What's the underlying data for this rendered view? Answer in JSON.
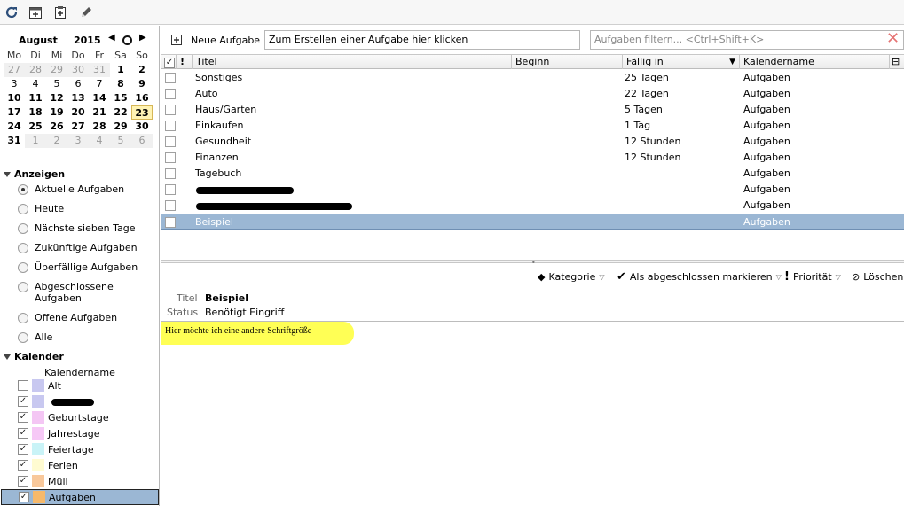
{
  "toolbar": {
    "icons": [
      "refresh-icon",
      "new-appointment-icon",
      "new-task-icon",
      "edit-icon"
    ]
  },
  "calendar": {
    "month": "August",
    "year": "2015",
    "dow": [
      "Mo",
      "Di",
      "Mi",
      "Do",
      "Fr",
      "Sa",
      "So"
    ],
    "weeks": [
      [
        "27",
        "28",
        "29",
        "30",
        "31",
        "1",
        "2"
      ],
      [
        "3",
        "4",
        "5",
        "6",
        "7",
        "8",
        "9"
      ],
      [
        "10",
        "11",
        "12",
        "13",
        "14",
        "15",
        "16"
      ],
      [
        "17",
        "18",
        "19",
        "20",
        "21",
        "22",
        "23"
      ],
      [
        "24",
        "25",
        "26",
        "27",
        "28",
        "29",
        "30"
      ],
      [
        "31",
        "1",
        "2",
        "3",
        "4",
        "5",
        "6"
      ]
    ]
  },
  "sections": {
    "show": "Anzeigen",
    "calendar": "Kalender",
    "calendar_col": "Kalendername"
  },
  "filters": [
    {
      "label": "Aktuelle Aufgaben",
      "selected": true
    },
    {
      "label": "Heute"
    },
    {
      "label": "Nächste sieben Tage"
    },
    {
      "label": "Zukünftige Aufgaben"
    },
    {
      "label": "Überfällige Aufgaben"
    },
    {
      "label": "Abgeschlossene Aufgaben"
    },
    {
      "label": "Offene Aufgaben"
    },
    {
      "label": "Alle"
    }
  ],
  "calendars": [
    {
      "label": "Alt",
      "checked": false,
      "color": "#c8c8f0"
    },
    {
      "label": "",
      "checked": true,
      "color": "#c8c8f0"
    },
    {
      "label": "Geburtstage",
      "checked": true,
      "color": "#f4c6f4"
    },
    {
      "label": "Jahrestage",
      "checked": true,
      "color": "#f6c8f6"
    },
    {
      "label": "Feiertage",
      "checked": true,
      "color": "#c9f3f7"
    },
    {
      "label": "Ferien",
      "checked": true,
      "color": "#fffbd1"
    },
    {
      "label": "Müll",
      "checked": true,
      "color": "#f8c89b"
    },
    {
      "label": "Aufgaben",
      "checked": true,
      "color": "#f6b96b",
      "selected": true
    }
  ],
  "newtask": {
    "label": "Neue Aufgabe",
    "placeholder": "Zum Erstellen einer Aufgabe hier klicken",
    "filter_placeholder": "Aufgaben filtern... <Ctrl+Shift+K>"
  },
  "columns": {
    "title": "Titel",
    "start": "Beginn",
    "due": "Fällig in",
    "calendar": "Kalendername"
  },
  "tasks": [
    {
      "title": "Sonstiges",
      "due": "25 Tagen",
      "calendar": "Aufgaben"
    },
    {
      "title": "Auto",
      "due": "22 Tagen",
      "calendar": "Aufgaben"
    },
    {
      "title": "Haus/Garten",
      "due": "5 Tagen",
      "calendar": "Aufgaben"
    },
    {
      "title": "Einkaufen",
      "due": "1 Tag",
      "calendar": "Aufgaben"
    },
    {
      "title": "Gesundheit",
      "due": "12 Stunden",
      "calendar": "Aufgaben"
    },
    {
      "title": "Finanzen",
      "due": "12 Stunden",
      "calendar": "Aufgaben"
    },
    {
      "title": "Tagebuch",
      "due": "",
      "calendar": "Aufgaben"
    },
    {
      "title": "",
      "due": "",
      "calendar": "Aufgaben"
    },
    {
      "title": "",
      "due": "",
      "calendar": "Aufgaben"
    },
    {
      "title": "Beispiel",
      "due": "",
      "calendar": "Aufgaben",
      "selected": true
    }
  ],
  "details": {
    "category": "Kategorie",
    "complete": "Als abgeschlossen markieren",
    "priority": "Priorität",
    "delete": "Löschen",
    "title_label": "Titel",
    "title_value": "Beispiel",
    "status_label": "Status",
    "status_value": "Benötigt Eingriff",
    "note": "Hier möchte ich eine andere Schriftgröße"
  }
}
